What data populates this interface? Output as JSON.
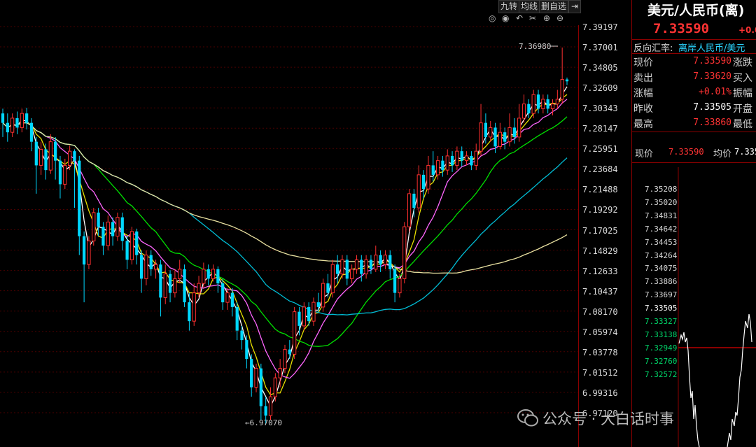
{
  "toolbar": {
    "buttons": [
      "九转",
      "均线",
      "删自选"
    ],
    "icons": [
      "eye-icon",
      "view-icon",
      "undo-icon",
      "scissors-icon",
      "zoom-in-icon",
      "zoom-out-icon"
    ]
  },
  "price_axis": [
    "7.39197",
    "7.37001",
    "7.34805",
    "7.32609",
    "7.30343",
    "7.28147",
    "7.25951",
    "7.23684",
    "7.21488",
    "7.19292",
    "7.17025",
    "7.14829",
    "7.12633",
    "7.10437",
    "7.08170",
    "7.05974",
    "7.03778",
    "7.01512",
    "6.99316",
    "6.97120"
  ],
  "annotations": {
    "high_label": "7.36980",
    "low_label": "←6.97070"
  },
  "quote": {
    "title": "美元/人民币(离)",
    "price": "7.33590",
    "change": "+0.0",
    "link_label": "反向汇率:",
    "link_text": "离岸人民币/美元",
    "rows": [
      {
        "label": "现价",
        "value": "7.33590",
        "label2": "涨跌",
        "color": "red"
      },
      {
        "label": "卖出",
        "value": "7.33620",
        "label2": "买入",
        "color": "red"
      },
      {
        "label": "涨幅",
        "value": "+0.01%",
        "label2": "振幅",
        "color": "red"
      },
      {
        "label": "昨收",
        "value": "7.33505",
        "label2": "开盘",
        "color": "white"
      },
      {
        "label": "最高",
        "value": "7.33860",
        "label2": "最低",
        "color": "red"
      }
    ]
  },
  "intraday": {
    "now_label": "现价",
    "now_value": "7.33590",
    "avg_label": "均价",
    "avg_value": "7.335",
    "axis": [
      "7.35208",
      "7.35020",
      "7.34831",
      "7.34642",
      "7.34453",
      "7.34264",
      "7.34075",
      "7.33886",
      "7.33697",
      "7.33505",
      "7.33327",
      "7.33138",
      "7.32949",
      "7.32760",
      "7.32572"
    ]
  },
  "watermark": "公众号 · 大白话时事",
  "colors": {
    "up": "#ff3030",
    "down": "#00d8ff",
    "ma1": "#ffffff",
    "ma2": "#e8e000",
    "ma3": "#ff66ff",
    "ma4": "#00e000",
    "ma5": "#00bcd4",
    "ma6": "#e8e0a0"
  },
  "chart_data": {
    "type": "candlestick",
    "ylim": [
      6.9712,
      7.39197
    ],
    "candles": [
      [
        7.3,
        7.29,
        7.305,
        7.275
      ],
      [
        7.29,
        7.28,
        7.3,
        7.27
      ],
      [
        7.28,
        7.295,
        7.3,
        7.275
      ],
      [
        7.295,
        7.285,
        7.302,
        7.278
      ],
      [
        7.285,
        7.3,
        7.305,
        7.28
      ],
      [
        7.3,
        7.29,
        7.306,
        7.283
      ],
      [
        7.29,
        7.27,
        7.295,
        7.26
      ],
      [
        7.27,
        7.245,
        7.275,
        7.215
      ],
      [
        7.245,
        7.262,
        7.27,
        7.235
      ],
      [
        7.262,
        7.24,
        7.268,
        7.23
      ],
      [
        7.24,
        7.27,
        7.278,
        7.236
      ],
      [
        7.27,
        7.25,
        7.275,
        7.23
      ],
      [
        7.25,
        7.225,
        7.255,
        7.21
      ],
      [
        7.225,
        7.245,
        7.252,
        7.22
      ],
      [
        7.245,
        7.26,
        7.266,
        7.24
      ],
      [
        7.26,
        7.25,
        7.262,
        7.2
      ],
      [
        7.25,
        7.17,
        7.255,
        7.15
      ],
      [
        7.17,
        7.14,
        7.175,
        7.1
      ],
      [
        7.14,
        7.165,
        7.17,
        7.135
      ],
      [
        7.165,
        7.195,
        7.2,
        7.16
      ],
      [
        7.195,
        7.18,
        7.2,
        7.17
      ],
      [
        7.18,
        7.16,
        7.185,
        7.15
      ],
      [
        7.16,
        7.185,
        7.192,
        7.155
      ],
      [
        7.185,
        7.17,
        7.19,
        7.16
      ],
      [
        7.17,
        7.19,
        7.195,
        7.165
      ],
      [
        7.19,
        7.165,
        7.195,
        7.155
      ],
      [
        7.165,
        7.145,
        7.17,
        7.135
      ],
      [
        7.145,
        7.175,
        7.18,
        7.14
      ],
      [
        7.175,
        7.15,
        7.178,
        7.14
      ],
      [
        7.15,
        7.125,
        7.155,
        7.11
      ],
      [
        7.125,
        7.15,
        7.155,
        7.118
      ],
      [
        7.15,
        7.135,
        7.155,
        7.128
      ],
      [
        7.135,
        7.14,
        7.145,
        7.125
      ],
      [
        7.14,
        7.105,
        7.145,
        7.085
      ],
      [
        7.105,
        7.13,
        7.14,
        7.098
      ],
      [
        7.13,
        7.11,
        7.134,
        7.1
      ],
      [
        7.11,
        7.125,
        7.135,
        7.105
      ],
      [
        7.125,
        7.135,
        7.145,
        7.12
      ],
      [
        7.135,
        7.1,
        7.14,
        7.095
      ],
      [
        7.1,
        7.08,
        7.11,
        7.07
      ],
      [
        7.08,
        7.11,
        7.12,
        7.075
      ],
      [
        7.11,
        7.12,
        7.128,
        7.105
      ],
      [
        7.12,
        7.135,
        7.142,
        7.115
      ],
      [
        7.135,
        7.125,
        7.14,
        7.118
      ],
      [
        7.125,
        7.135,
        7.14,
        7.122
      ],
      [
        7.135,
        7.12,
        7.138,
        7.11
      ],
      [
        7.12,
        7.1,
        7.125,
        7.092
      ],
      [
        7.1,
        7.11,
        7.115,
        7.092
      ],
      [
        7.11,
        7.095,
        7.115,
        7.085
      ],
      [
        7.095,
        7.07,
        7.1,
        7.06
      ],
      [
        7.07,
        7.06,
        7.075,
        7.05
      ],
      [
        7.06,
        7.04,
        7.065,
        7.03
      ],
      [
        7.04,
        7.01,
        7.045,
        7.0
      ],
      [
        7.01,
        7.03,
        7.035,
        7.005
      ],
      [
        7.03,
        6.99,
        7.035,
        6.975
      ],
      [
        6.99,
        6.98,
        7.0,
        6.971
      ],
      [
        6.98,
        7.0,
        7.01,
        6.975
      ],
      [
        7.0,
        7.02,
        7.025,
        6.995
      ],
      [
        7.02,
        7.03,
        7.04,
        7.01
      ],
      [
        7.03,
        7.05,
        7.055,
        7.025
      ],
      [
        7.05,
        7.045,
        7.06,
        7.04
      ],
      [
        7.045,
        7.09,
        7.095,
        7.04
      ],
      [
        7.09,
        7.075,
        7.095,
        7.065
      ],
      [
        7.075,
        7.095,
        7.1,
        7.07
      ],
      [
        7.095,
        7.08,
        7.1,
        7.075
      ],
      [
        7.08,
        7.1,
        7.105,
        7.075
      ],
      [
        7.1,
        7.095,
        7.11,
        7.09
      ],
      [
        7.095,
        7.12,
        7.125,
        7.09
      ],
      [
        7.12,
        7.11,
        7.13,
        7.105
      ],
      [
        7.11,
        7.14,
        7.145,
        7.105
      ],
      [
        7.14,
        7.13,
        7.15,
        7.12
      ],
      [
        7.13,
        7.145,
        7.15,
        7.125
      ],
      [
        7.145,
        7.125,
        7.15,
        7.118
      ],
      [
        7.125,
        7.135,
        7.14,
        7.12
      ],
      [
        7.135,
        7.145,
        7.15,
        7.13
      ],
      [
        7.145,
        7.13,
        7.15,
        7.122
      ],
      [
        7.13,
        7.145,
        7.15,
        7.125
      ],
      [
        7.145,
        7.135,
        7.15,
        7.13
      ],
      [
        7.135,
        7.15,
        7.16,
        7.132
      ],
      [
        7.15,
        7.14,
        7.155,
        7.132
      ],
      [
        7.14,
        7.15,
        7.155,
        7.135
      ],
      [
        7.15,
        7.135,
        7.155,
        7.125
      ],
      [
        7.135,
        7.11,
        7.14,
        7.1
      ],
      [
        7.11,
        7.125,
        7.13,
        7.105
      ],
      [
        7.125,
        7.18,
        7.185,
        7.12
      ],
      [
        7.18,
        7.215,
        7.22,
        7.175
      ],
      [
        7.215,
        7.2,
        7.22,
        7.19
      ],
      [
        7.2,
        7.235,
        7.245,
        7.195
      ],
      [
        7.235,
        7.22,
        7.24,
        7.21
      ],
      [
        7.22,
        7.245,
        7.255,
        7.215
      ],
      [
        7.245,
        7.235,
        7.26,
        7.228
      ],
      [
        7.235,
        7.25,
        7.255,
        7.23
      ],
      [
        7.25,
        7.24,
        7.255,
        7.233
      ],
      [
        7.24,
        7.255,
        7.262,
        7.235
      ],
      [
        7.255,
        7.245,
        7.26,
        7.238
      ],
      [
        7.245,
        7.26,
        7.265,
        7.24
      ],
      [
        7.26,
        7.25,
        7.265,
        7.244
      ],
      [
        7.25,
        7.255,
        7.26,
        7.245
      ],
      [
        7.255,
        7.245,
        7.26,
        7.24
      ],
      [
        7.245,
        7.26,
        7.268,
        7.24
      ],
      [
        7.26,
        7.29,
        7.31,
        7.255
      ],
      [
        7.29,
        7.275,
        7.3,
        7.268
      ],
      [
        7.275,
        7.285,
        7.292,
        7.27
      ],
      [
        7.285,
        7.265,
        7.29,
        7.258
      ],
      [
        7.265,
        7.28,
        7.29,
        7.262
      ],
      [
        7.28,
        7.27,
        7.285,
        7.262
      ],
      [
        7.27,
        7.285,
        7.3,
        7.265
      ],
      [
        7.285,
        7.275,
        7.295,
        7.268
      ],
      [
        7.275,
        7.295,
        7.31,
        7.27
      ],
      [
        7.295,
        7.31,
        7.32,
        7.29
      ],
      [
        7.31,
        7.3,
        7.315,
        7.295
      ],
      [
        7.3,
        7.32,
        7.325,
        7.295
      ],
      [
        7.32,
        7.305,
        7.325,
        7.3
      ],
      [
        7.305,
        7.315,
        7.32,
        7.3
      ],
      [
        7.315,
        7.305,
        7.32,
        7.3
      ],
      [
        7.305,
        7.31,
        7.315,
        7.298
      ],
      [
        7.31,
        7.315,
        7.325,
        7.305
      ],
      [
        7.315,
        7.336,
        7.3698,
        7.31
      ],
      [
        7.336,
        7.334,
        7.338,
        7.33
      ]
    ],
    "ma_series": [
      {
        "color": "#ffffff",
        "values": []
      },
      {
        "color": "#e8e000",
        "values": []
      },
      {
        "color": "#ff66ff",
        "values": []
      },
      {
        "color": "#00e000",
        "values": []
      },
      {
        "color": "#00bcd4",
        "values": []
      },
      {
        "color": "#e8e0a0",
        "values": []
      }
    ]
  }
}
